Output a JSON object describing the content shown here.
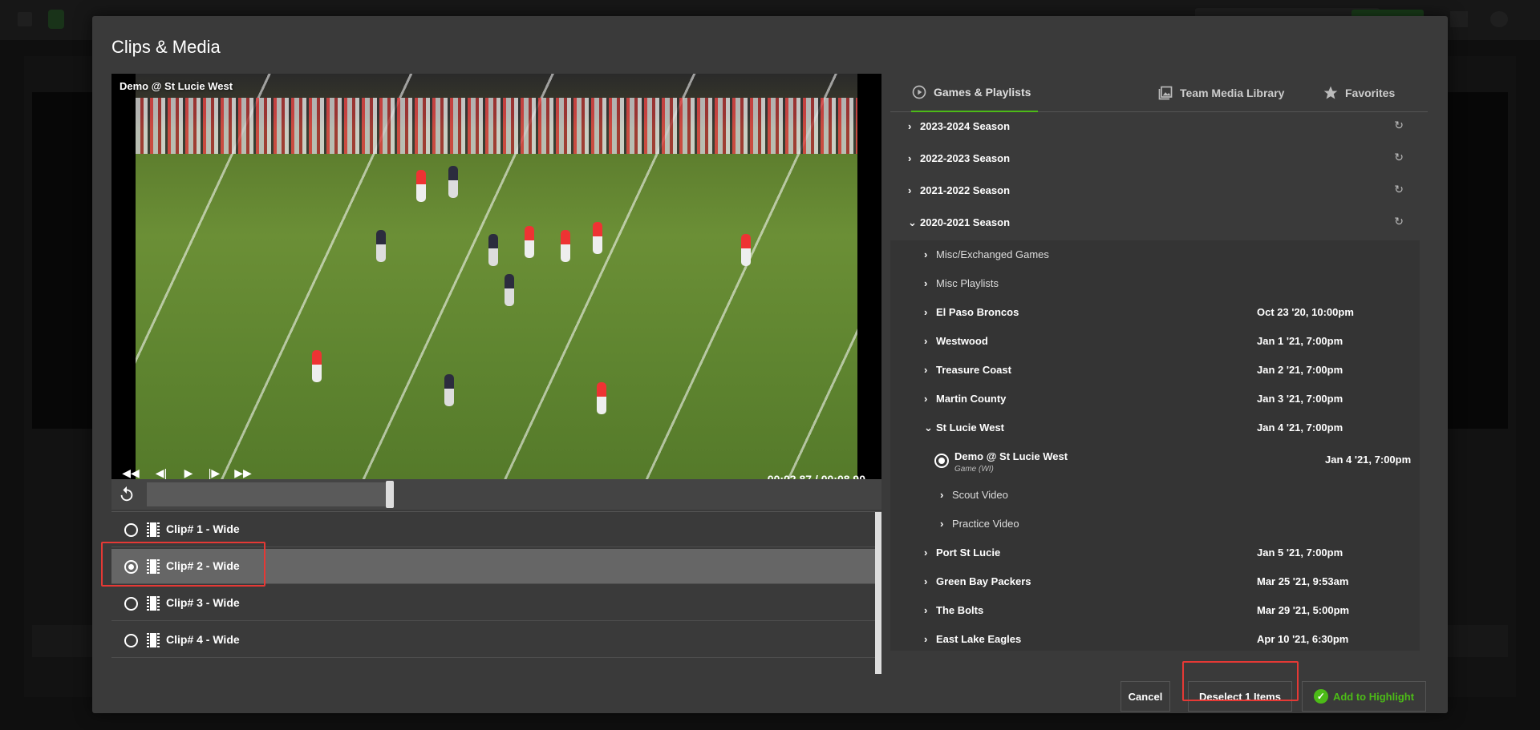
{
  "modal": {
    "title": "Clips & Media"
  },
  "video": {
    "title": "Demo @ St Lucie West",
    "timecode": "00:02.87 / 00:08.90",
    "controls": {
      "rewind": "◀◀",
      "step_back": "◀|",
      "play": "▶",
      "step_forward": "|▶",
      "fast_forward": "▶▶"
    }
  },
  "clips": [
    {
      "label": "Clip# 1 - Wide",
      "selected": false
    },
    {
      "label": "Clip# 2 - Wide",
      "selected": true
    },
    {
      "label": "Clip# 3 - Wide",
      "selected": false
    },
    {
      "label": "Clip# 4 - Wide",
      "selected": false
    }
  ],
  "tabs": [
    {
      "label": "Games & Playlists",
      "icon": "play-circle-icon",
      "active": true
    },
    {
      "label": "Team Media Library",
      "icon": "photo-library-icon",
      "active": false
    },
    {
      "label": "Favorites",
      "icon": "star-icon",
      "active": false
    }
  ],
  "tree": {
    "seasons": [
      {
        "label": "2023-2024 Season",
        "expanded": false
      },
      {
        "label": "2022-2023 Season",
        "expanded": false
      },
      {
        "label": "2021-2022 Season",
        "expanded": false
      },
      {
        "label": "2020-2021 Season",
        "expanded": true
      }
    ],
    "folders": [
      {
        "label": "Misc/Exchanged Games"
      },
      {
        "label": "Misc Playlists"
      }
    ],
    "games_before": [
      {
        "label": "El Paso Broncos",
        "date": "Oct 23 '20, 10:00pm"
      },
      {
        "label": "Westwood",
        "date": "Jan 1 '21, 7:00pm"
      },
      {
        "label": "Treasure Coast",
        "date": "Jan 2 '21, 7:00pm"
      },
      {
        "label": "Martin County",
        "date": "Jan 3 '21, 7:00pm"
      },
      {
        "label": "St Lucie West",
        "date": "Jan 4 '21, 7:00pm"
      }
    ],
    "expanded_game": {
      "name": "Demo @ St Lucie West",
      "type": "Game (WI)",
      "date": "Jan 4 '21, 7:00pm",
      "children": [
        {
          "label": "Scout Video"
        },
        {
          "label": "Practice Video"
        }
      ]
    },
    "games_after": [
      {
        "label": "Port St Lucie",
        "date": "Jan 5 '21, 7:00pm"
      },
      {
        "label": "Green Bay Packers",
        "date": "Mar 25 '21, 9:53am"
      },
      {
        "label": "The Bolts",
        "date": "Mar 29 '21, 5:00pm"
      },
      {
        "label": "East Lake Eagles",
        "date": "Apr 10 '21, 6:30pm"
      }
    ]
  },
  "footer": {
    "cancel_label": "Cancel",
    "deselect_label": "Deselect 1 Items",
    "add_label": "Add to Highlight"
  },
  "colors": {
    "accent": "#4cbb17",
    "highlight": "#e53935"
  }
}
